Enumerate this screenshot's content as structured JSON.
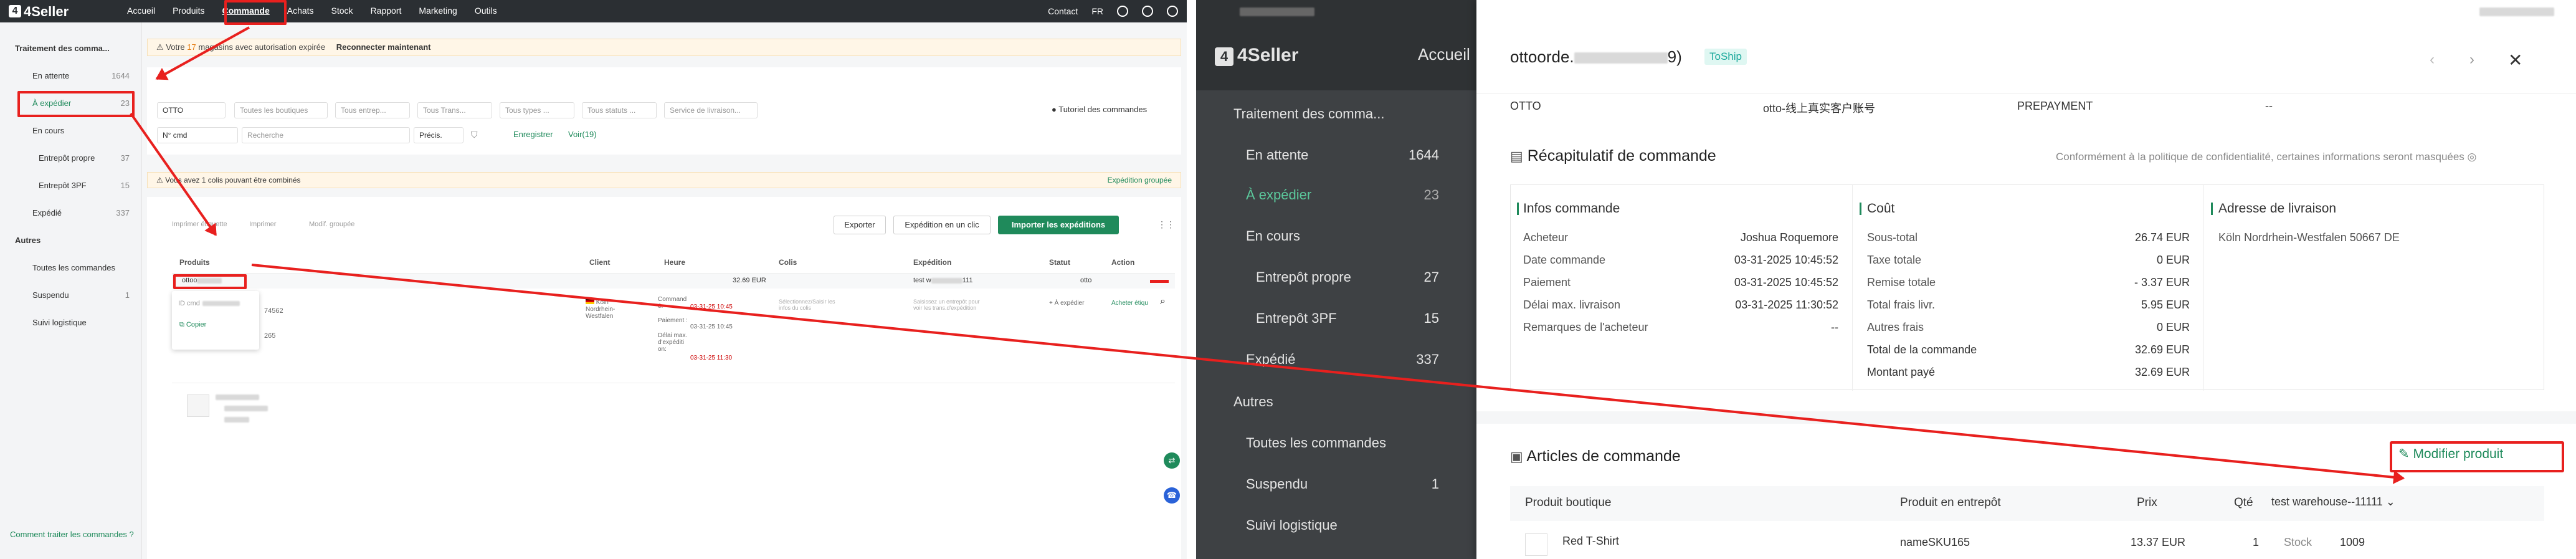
{
  "left_app": {
    "logo": "4Seller",
    "nav": [
      "Accueil",
      "Produits",
      "Commande",
      "Achats",
      "Stock",
      "Rapport",
      "Marketing",
      "Outils"
    ],
    "top_right": {
      "contact": "Contact",
      "lang": "FR"
    },
    "sidebar": {
      "section1": "Traitement des comma...",
      "items": [
        {
          "label": "En attente",
          "count": "1644"
        },
        {
          "label": "À expédier",
          "count": "23"
        },
        {
          "label": "En cours",
          "count": ""
        },
        {
          "label": "Entrepôt propre",
          "count": "37"
        },
        {
          "label": "Entrepôt 3PF",
          "count": "15"
        },
        {
          "label": "Expédié",
          "count": "337"
        }
      ],
      "section2": "Autres",
      "items2": [
        {
          "label": "Toutes les commandes",
          "count": ""
        },
        {
          "label": "Suspendu",
          "count": "1"
        },
        {
          "label": "Suivi logistique",
          "count": ""
        }
      ],
      "help": "Comment traiter les commandes ?"
    },
    "warning": {
      "prefix": "Votre",
      "count": "17",
      "suffix": "magasins avec autorisation expirée",
      "action": "Reconnecter maintenant"
    },
    "filters": [
      "OTTO",
      "Toutes les boutiques",
      "Tous entrep...",
      "Tous Trans...",
      "Tous types ...",
      "Tous statuts ...",
      "Service de livraison..."
    ],
    "tutorial": "Tutoriel des commandes",
    "search": {
      "type": "N° cmd",
      "placeholder": "Recherche",
      "precis": "Précis.",
      "save": "Enregistrer",
      "view": "Voir(19)"
    },
    "combine_banner": {
      "text": "Vous avez 1 colis pouvant être combinés",
      "link": "Expédition groupée"
    },
    "toolbar": {
      "print_label": "Imprimer étiquette",
      "print": "Imprimer",
      "modify": "Modif. groupée",
      "export": "Exporter",
      "one_click": "Expédition en un clic",
      "import": "Importer les expéditions"
    },
    "table_headers": [
      "Produits",
      "Client",
      "Heure",
      "Colis",
      "Expédition",
      "Statut",
      "Action"
    ],
    "row": {
      "order_id": "ottoo",
      "popup_label": "ID cmd",
      "copy": "Copier",
      "partial1": "74562",
      "partial2": "265",
      "amount": "32.69 EUR",
      "client": "Köln Nordrhein-Westfalen",
      "commande_label": "Command é:",
      "commande_time": "03-31-25 10:45",
      "paiement_label": "Paiement :",
      "paiement_time": "03-31-25 10:45",
      "delai_label": "Délai max. d'expéditi on:",
      "delai_time": "03-31-25 11:30",
      "colis": "Sélectionnez/Saisir les infos du colis",
      "expedition": "test w",
      "expedition_suffix": "111",
      "expedition_hint": "Saisissez un entrepôt pour voir les trans.d'expédition",
      "statut": "À expédier",
      "statut_prefix": "otto",
      "action": "Acheter étiqu"
    }
  },
  "right_app": {
    "logo": "4Seller",
    "nav_home": "Accueil",
    "dim_sidebar": [
      {
        "label": "Traitement des comma...",
        "count": ""
      },
      {
        "label": "En attente",
        "count": "1644"
      },
      {
        "label": "À expédier",
        "count": "23"
      },
      {
        "label": "En cours",
        "count": ""
      },
      {
        "label": "Entrepôt propre",
        "count": "27"
      },
      {
        "label": "Entrepôt 3PF",
        "count": "15"
      },
      {
        "label": "Expédié",
        "count": "337"
      },
      {
        "label": "Autres",
        "count": ""
      },
      {
        "label": "Toutes les commandes",
        "count": ""
      },
      {
        "label": "Suspendu",
        "count": "1"
      },
      {
        "label": "Suivi logistique",
        "count": ""
      }
    ],
    "drawer": {
      "title_prefix": "ottoorde.",
      "title_suffix": "9)",
      "tag": "ToShip",
      "top_row": {
        "platform": "OTTO",
        "account": "otto-线上真实客户账号",
        "payment": "PREPAYMENT",
        "dash": "--"
      },
      "summary_title": "Récapitulatif de commande",
      "privacy": "Conformément à la politique de confidentialité, certaines informations seront masquées",
      "info_title": "Infos commande",
      "info": [
        {
          "k": "Acheteur",
          "v": "Joshua Roquemore"
        },
        {
          "k": "Date commande",
          "v": "03-31-2025 10:45:52"
        },
        {
          "k": "Paiement",
          "v": "03-31-2025 10:45:52"
        },
        {
          "k": "Délai max. livraison",
          "v": "03-31-2025 11:30:52"
        },
        {
          "k": "Remarques de l'acheteur",
          "v": "--"
        }
      ],
      "cost_title": "Coût",
      "cost": [
        {
          "k": "Sous-total",
          "v": "26.74 EUR"
        },
        {
          "k": "Taxe totale",
          "v": "0 EUR"
        },
        {
          "k": "Remise totale",
          "v": "- 3.37 EUR"
        },
        {
          "k": "Total frais livr.",
          "v": "5.95 EUR"
        },
        {
          "k": "Autres frais",
          "v": "0 EUR"
        },
        {
          "k": "Total de la commande",
          "v": "32.69 EUR"
        },
        {
          "k": "Montant payé",
          "v": "32.69 EUR"
        }
      ],
      "address_title": "Adresse de livraison",
      "address": "Köln Nordrhein-Westfalen 50667 DE",
      "articles_title": "Articles de commande",
      "modify_button": "Modifier produit",
      "columns": [
        "Produit boutique",
        "Produit en entrepôt",
        "Prix",
        "Qté"
      ],
      "warehouse_select": "test warehouse--11111",
      "item": {
        "name": "Red T-Shirt",
        "sku": "nameSKU165",
        "price": "13.37 EUR",
        "qty": "1",
        "stock_label": "Stock",
        "stock": "1009"
      }
    }
  }
}
